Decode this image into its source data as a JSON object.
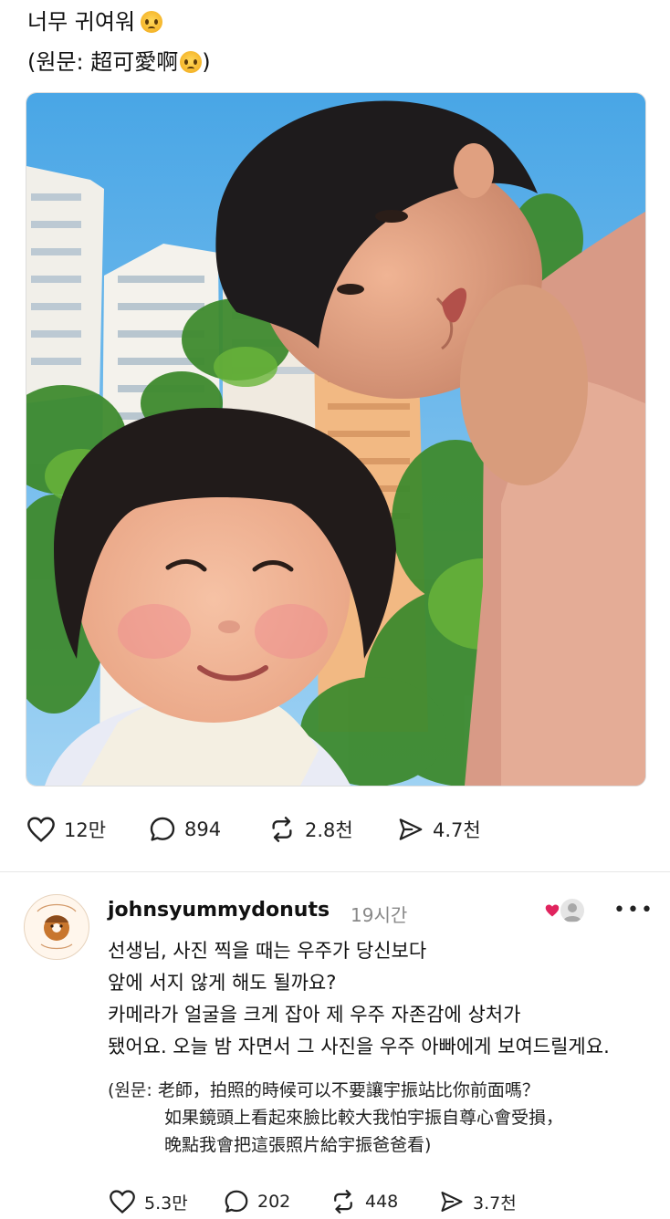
{
  "post": {
    "caption": "너무 귀여워",
    "caption_emoji": "crying-face-emoji",
    "original_prefix": "(원문: 超可愛啊",
    "original_suffix": ")",
    "stats": {
      "likes": "12만",
      "comments": "894",
      "reposts": "2.8천",
      "shares": "4.7천"
    }
  },
  "comment": {
    "username": "johnsyummydonuts",
    "time": "19시간",
    "lines": [
      "선생님, 사진 찍을 때는 우주가 당신보다",
      "앞에 서지 않게 해도 될까요?",
      "카메라가 얼굴을 크게 잡아 제 우주 자존감에 상처가",
      "됐어요. 오늘 밤 자면서 그 사진을 우주 아빠에게 보여드릴게요."
    ],
    "original_lines": [
      "(원문: 老師，拍照的時候可以不要讓宇振站比你前面嗎？",
      "如果鏡頭上看起來臉比較大我怕宇振自尊心會受損，",
      "晚點我會把這張照片給宇振爸爸看)"
    ],
    "more_label": "•••",
    "stats": {
      "likes": "5.3만",
      "comments": "202",
      "reposts": "448",
      "shares": "3.7천"
    }
  },
  "colors": {
    "heart_liked": "#e0245e",
    "text_secondary": "#888888"
  }
}
